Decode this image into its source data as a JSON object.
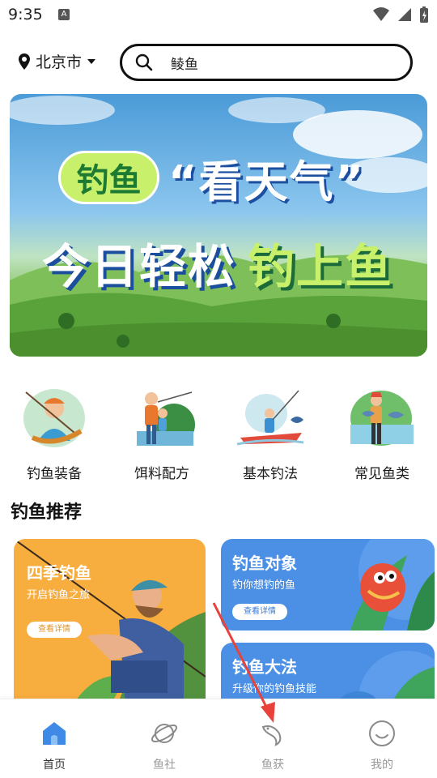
{
  "status_bar": {
    "time": "9:35",
    "notification_icon": "A"
  },
  "location": {
    "city": "北京市"
  },
  "search": {
    "value": "鲮鱼"
  },
  "banner": {
    "tag": "钓鱼",
    "quote": "“看天气”",
    "main": "今日轻松",
    "highlight": "钓上鱼"
  },
  "categories": [
    {
      "label": "钓鱼装备",
      "icon": "fishing-gear-icon"
    },
    {
      "label": "饵料配方",
      "icon": "bait-recipe-icon"
    },
    {
      "label": "基本钓法",
      "icon": "fishing-method-icon"
    },
    {
      "label": "常见鱼类",
      "icon": "common-fish-icon"
    }
  ],
  "recommend": {
    "title": "钓鱼推荐",
    "cards": [
      {
        "title": "四季钓鱼",
        "subtitle": "开启钓鱼之旅",
        "button": "查看详情"
      },
      {
        "title": "钓鱼对象",
        "subtitle": "钓你想钓的鱼",
        "button": "查看详情"
      },
      {
        "title": "钓鱼大法",
        "subtitle": "升级你的钓鱼技能"
      }
    ]
  },
  "nav": [
    {
      "label": "首页",
      "icon": "home-icon",
      "active": true
    },
    {
      "label": "鱼社",
      "icon": "planet-icon",
      "active": false
    },
    {
      "label": "鱼获",
      "icon": "fish-icon",
      "active": false
    },
    {
      "label": "我的",
      "icon": "smiley-icon",
      "active": false
    }
  ],
  "colors": {
    "accent_blue": "#4c90e6",
    "accent_orange": "#f8ad3f",
    "banner_green": "#c8f06a",
    "annotation_red": "#e8423a"
  }
}
